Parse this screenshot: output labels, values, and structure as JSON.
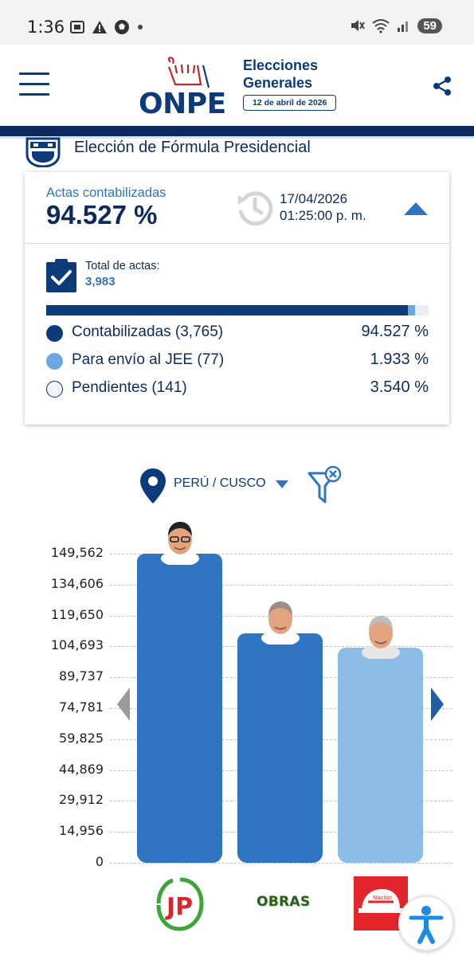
{
  "status_bar": {
    "time": "1:36",
    "battery": "59",
    "icons": [
      "screenshot-icon",
      "warning-icon",
      "soccer-icon",
      "dot-icon",
      "mute-icon",
      "wifi-icon",
      "signal-icon"
    ]
  },
  "header": {
    "logo_text": "ONPE",
    "title_line1": "Elecciones",
    "title_line2": "Generales",
    "date_badge": "12 de abril de 2026",
    "menu_icon": "hamburger-icon",
    "share_icon": "share-icon"
  },
  "section": {
    "title": "Elección de Fórmula Presidencial"
  },
  "summary": {
    "actas_label": "Actas contabilizadas",
    "actas_percent": "94.527 %",
    "update_date": "17/04/2026",
    "update_time": "01:25:00 p. m.",
    "total_label": "Total de actas:",
    "total_value": "3,983",
    "progress": [
      {
        "name": "contabilizadas",
        "fraction": 0.94527,
        "color": "#0d3a78"
      },
      {
        "name": "jee",
        "fraction": 0.01933,
        "color": "#6aa6e0"
      },
      {
        "name": "pendientes",
        "fraction": 0.0354,
        "color": "#e7eef6"
      }
    ],
    "legend": [
      {
        "label": "Contabilizadas (3,765)",
        "value": "94.527 %",
        "color": "#0d3a78"
      },
      {
        "label": "Para envío al JEE (77)",
        "value": "1.933 %",
        "color": "#6aa6e0"
      },
      {
        "label": "Pendientes (141)",
        "value": "3.540 %",
        "color": "#f2f5f9"
      }
    ]
  },
  "location": {
    "label": "PERÚ / CUSCO"
  },
  "chart_data": {
    "type": "bar",
    "categories": [
      "JP",
      "OBRAS",
      "Nación"
    ],
    "values": [
      149562,
      111000,
      104000
    ],
    "ylim": [
      0,
      149562
    ],
    "yticks": [
      "149,562",
      "134,606",
      "119,650",
      "104,693",
      "89,737",
      "74,781",
      "59,825",
      "44,869",
      "29,912",
      "14,956",
      "0"
    ],
    "colors": [
      "#2f74c0",
      "#2f74c0",
      "#8bbde6"
    ],
    "grid": true
  },
  "parties": [
    {
      "name": "JP",
      "logo_text": "JP"
    },
    {
      "name": "OBRAS",
      "logo_text": "OBRAS"
    },
    {
      "name": "Nación",
      "logo_text": "Nación"
    }
  ]
}
